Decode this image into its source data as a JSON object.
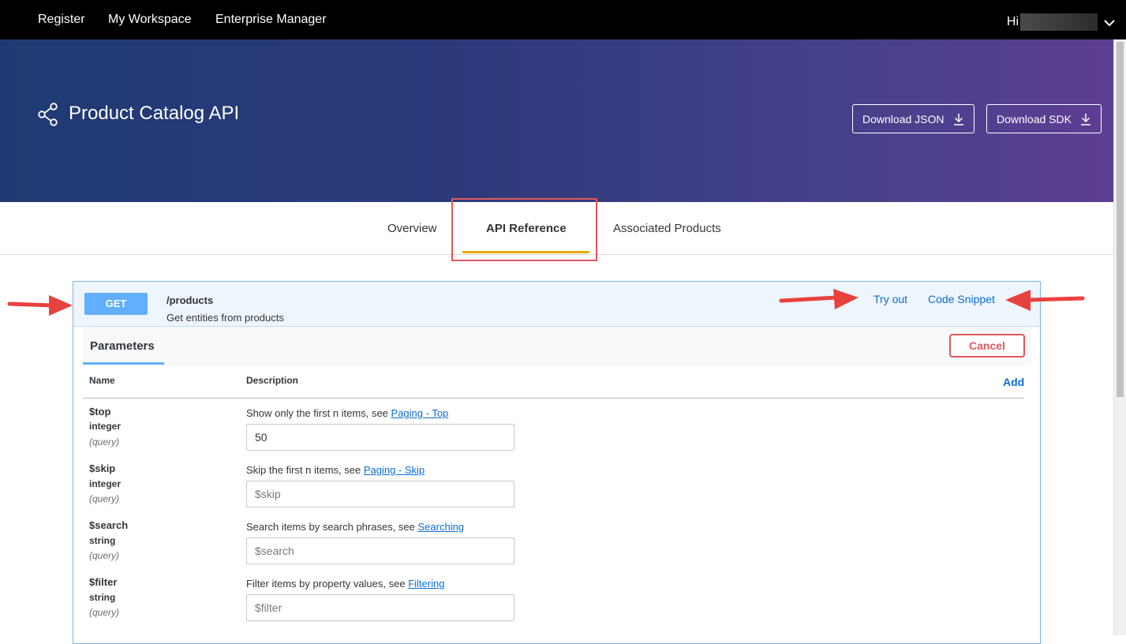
{
  "topnav": {
    "items": [
      "Register",
      "My Workspace",
      "Enterprise Manager"
    ],
    "user_greeting": "Hi"
  },
  "header": {
    "title": "Product Catalog API",
    "download_json": "Download JSON",
    "download_sdk": "Download SDK"
  },
  "tabs": [
    "Overview",
    "API Reference",
    "Associated Products"
  ],
  "active_tab": "API Reference",
  "endpoint": {
    "method": "GET",
    "path": "/products",
    "summary": "Get entities from products",
    "try_out": "Try out",
    "code_snippet": "Code Snippet"
  },
  "parameters": {
    "title": "Parameters",
    "cancel": "Cancel",
    "col_name": "Name",
    "col_description": "Description",
    "add": "Add",
    "items": [
      {
        "name": "$top",
        "type": "integer",
        "in": "(query)",
        "desc": "Show only the first n items, see ",
        "link": "Paging - Top",
        "value": "50",
        "placeholder": ""
      },
      {
        "name": "$skip",
        "type": "integer",
        "in": "(query)",
        "desc": "Skip the first n items, see ",
        "link": "Paging - Skip",
        "value": "",
        "placeholder": "$skip"
      },
      {
        "name": "$search",
        "type": "string",
        "in": "(query)",
        "desc": "Search items by search phrases, see ",
        "link": "Searching",
        "value": "",
        "placeholder": "$search"
      },
      {
        "name": "$filter",
        "type": "string",
        "in": "(query)",
        "desc": "Filter items by property values, see ",
        "link": "Filtering",
        "value": "",
        "placeholder": "$filter"
      }
    ]
  },
  "colors": {
    "accent_blue": "#0a6ed1",
    "get_badge": "#61affe",
    "tab_underline": "#e9a600",
    "highlight_red": "#e0585b"
  }
}
